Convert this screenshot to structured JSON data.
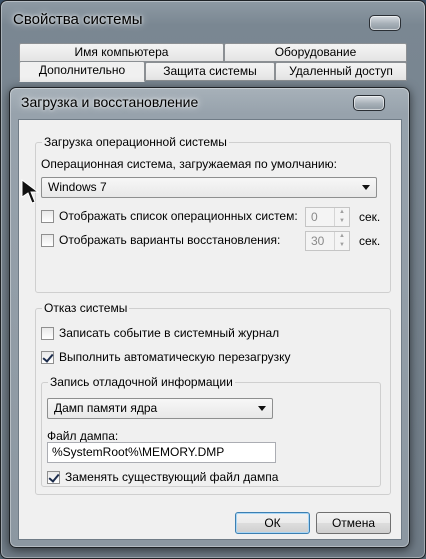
{
  "outer_window": {
    "title": "Свойства системы",
    "tabs_row1": [
      "Имя компьютера",
      "Оборудование"
    ],
    "tabs_row2": [
      "Дополнительно",
      "Защита системы",
      "Удаленный доступ"
    ],
    "active_tab": "Дополнительно"
  },
  "dialog": {
    "title": "Загрузка и восстановление",
    "startup_group": {
      "label": "Загрузка операционной системы",
      "default_os_label": "Операционная система, загружаемая по умолчанию:",
      "default_os_value": "Windows 7",
      "show_os_list": {
        "label": "Отображать список операционных систем:",
        "checked": false,
        "value": "0",
        "unit": "сек."
      },
      "show_recovery": {
        "label": "Отображать варианты восстановления:",
        "checked": false,
        "value": "30",
        "unit": "сек."
      }
    },
    "failure_group": {
      "label": "Отказ системы",
      "write_event": {
        "label": "Записать событие в системный журнал",
        "checked": false
      },
      "auto_restart": {
        "label": "Выполнить автоматическую перезагрузку",
        "checked": true
      },
      "debug_group": {
        "label": "Запись отладочной информации",
        "dump_type": "Дамп памяти ядра",
        "dump_file_label": "Файл дампа:",
        "dump_file_value": "%SystemRoot%\\MEMORY.DMP",
        "overwrite": {
          "label": "Заменять существующий файл дампа",
          "checked": true
        }
      }
    },
    "ok_label": "ОК",
    "cancel_label": "Отмена"
  }
}
